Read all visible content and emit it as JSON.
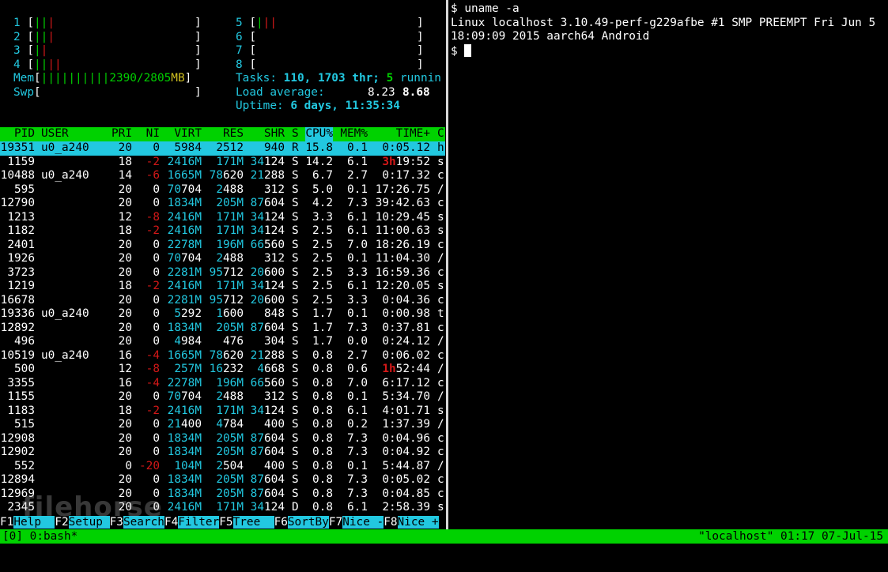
{
  "htop": {
    "cpus": [
      {
        "id": "1",
        "bars": [
          {
            "t": "|",
            "c": "g"
          },
          {
            "t": "|",
            "c": "g"
          },
          {
            "t": "|",
            "c": "r"
          }
        ]
      },
      {
        "id": "2",
        "bars": [
          {
            "t": "|",
            "c": "g"
          },
          {
            "t": "|",
            "c": "g"
          },
          {
            "t": "|",
            "c": "r"
          }
        ]
      },
      {
        "id": "3",
        "bars": [
          {
            "t": "|",
            "c": "g"
          },
          {
            "t": "|",
            "c": "r"
          }
        ]
      },
      {
        "id": "4",
        "bars": [
          {
            "t": "|",
            "c": "g"
          },
          {
            "t": "|",
            "c": "g"
          },
          {
            "t": "|",
            "c": "r"
          },
          {
            "t": "|",
            "c": "r"
          }
        ]
      },
      {
        "id": "5",
        "bars": [
          {
            "t": "|",
            "c": "g"
          },
          {
            "t": "|",
            "c": "r"
          },
          {
            "t": "|",
            "c": "r"
          }
        ]
      },
      {
        "id": "6",
        "bars": []
      },
      {
        "id": "7",
        "bars": []
      },
      {
        "id": "8",
        "bars": []
      }
    ],
    "mem_label": "Mem",
    "mem_bars": "||||||||||",
    "mem_used": "2390",
    "mem_total": "/2805",
    "mem_unit": "MB",
    "swp_label": "Swp",
    "tasks_label": "Tasks: ",
    "tasks_value": "110, 1703 thr; ",
    "running_value": "5",
    "running_label": " runnin",
    "load_label": "Load average: ",
    "load_1": "8.23",
    "load_5": "8.68",
    "uptime_label": "Uptime: ",
    "uptime_value": "6 days, 11:35:34",
    "columns": [
      "PID",
      "USER",
      "PRI",
      "NI",
      "VIRT",
      "RES",
      "SHR",
      "S",
      "CPU%",
      "MEM%",
      "TIME+",
      "C"
    ],
    "processes": [
      {
        "pid": "19351",
        "user": "u0_a240",
        "pri": "20",
        "ni": "0",
        "virt": "5984",
        "res": "2512",
        "shr": "940",
        "s": "R",
        "cpu": "15.8",
        "mem": "0.1",
        "time": "0:05.12",
        "cmd": "h",
        "sel": true
      },
      {
        "pid": "1159",
        "user": "",
        "pri": "18",
        "ni": "-2",
        "virt": "2416M",
        "res": "171M",
        "shr": "34124",
        "s": "S",
        "cpu": "14.2",
        "mem": "6.1",
        "time": "3h19:52",
        "cmd": "s"
      },
      {
        "pid": "10488",
        "user": "u0_a240",
        "pri": "14",
        "ni": "-6",
        "virt": "1665M",
        "res": "78620",
        "shr": "21288",
        "s": "S",
        "cpu": "6.7",
        "mem": "2.7",
        "time": "0:17.32",
        "cmd": "c"
      },
      {
        "pid": "595",
        "user": "",
        "pri": "20",
        "ni": "0",
        "virt": "70704",
        "res": "2488",
        "shr": "312",
        "s": "S",
        "cpu": "5.0",
        "mem": "0.1",
        "time": "17:26.75",
        "cmd": "/"
      },
      {
        "pid": "12790",
        "user": "",
        "pri": "20",
        "ni": "0",
        "virt": "1834M",
        "res": "205M",
        "shr": "87604",
        "s": "S",
        "cpu": "4.2",
        "mem": "7.3",
        "time": "39:42.63",
        "cmd": "c"
      },
      {
        "pid": "1213",
        "user": "",
        "pri": "12",
        "ni": "-8",
        "virt": "2416M",
        "res": "171M",
        "shr": "34124",
        "s": "S",
        "cpu": "3.3",
        "mem": "6.1",
        "time": "10:29.45",
        "cmd": "s"
      },
      {
        "pid": "1182",
        "user": "",
        "pri": "18",
        "ni": "-2",
        "virt": "2416M",
        "res": "171M",
        "shr": "34124",
        "s": "S",
        "cpu": "2.5",
        "mem": "6.1",
        "time": "11:00.63",
        "cmd": "s"
      },
      {
        "pid": "2401",
        "user": "",
        "pri": "20",
        "ni": "0",
        "virt": "2278M",
        "res": "196M",
        "shr": "66560",
        "s": "S",
        "cpu": "2.5",
        "mem": "7.0",
        "time": "18:26.19",
        "cmd": "c"
      },
      {
        "pid": "1926",
        "user": "",
        "pri": "20",
        "ni": "0",
        "virt": "70704",
        "res": "2488",
        "shr": "312",
        "s": "S",
        "cpu": "2.5",
        "mem": "0.1",
        "time": "11:04.30",
        "cmd": "/"
      },
      {
        "pid": "3723",
        "user": "",
        "pri": "20",
        "ni": "0",
        "virt": "2281M",
        "res": "95712",
        "shr": "20600",
        "s": "S",
        "cpu": "2.5",
        "mem": "3.3",
        "time": "16:59.36",
        "cmd": "c"
      },
      {
        "pid": "1219",
        "user": "",
        "pri": "18",
        "ni": "-2",
        "virt": "2416M",
        "res": "171M",
        "shr": "34124",
        "s": "S",
        "cpu": "2.5",
        "mem": "6.1",
        "time": "12:20.05",
        "cmd": "s"
      },
      {
        "pid": "16678",
        "user": "",
        "pri": "20",
        "ni": "0",
        "virt": "2281M",
        "res": "95712",
        "shr": "20600",
        "s": "S",
        "cpu": "2.5",
        "mem": "3.3",
        "time": "0:04.36",
        "cmd": "c"
      },
      {
        "pid": "19336",
        "user": "u0_a240",
        "pri": "20",
        "ni": "0",
        "virt": "5292",
        "res": "1600",
        "shr": "848",
        "s": "S",
        "cpu": "1.7",
        "mem": "0.1",
        "time": "0:00.98",
        "cmd": "t"
      },
      {
        "pid": "12892",
        "user": "",
        "pri": "20",
        "ni": "0",
        "virt": "1834M",
        "res": "205M",
        "shr": "87604",
        "s": "S",
        "cpu": "1.7",
        "mem": "7.3",
        "time": "0:37.81",
        "cmd": "c"
      },
      {
        "pid": "496",
        "user": "",
        "pri": "20",
        "ni": "0",
        "virt": "4984",
        "res": "476",
        "shr": "304",
        "s": "S",
        "cpu": "1.7",
        "mem": "0.0",
        "time": "0:24.12",
        "cmd": "/"
      },
      {
        "pid": "10519",
        "user": "u0_a240",
        "pri": "16",
        "ni": "-4",
        "virt": "1665M",
        "res": "78620",
        "shr": "21288",
        "s": "S",
        "cpu": "0.8",
        "mem": "2.7",
        "time": "0:06.02",
        "cmd": "c"
      },
      {
        "pid": "500",
        "user": "",
        "pri": "12",
        "ni": "-8",
        "virt": "257M",
        "res": "16232",
        "shr": "4668",
        "s": "S",
        "cpu": "0.8",
        "mem": "0.6",
        "time": "1h52:44",
        "cmd": "/"
      },
      {
        "pid": "3355",
        "user": "",
        "pri": "16",
        "ni": "-4",
        "virt": "2278M",
        "res": "196M",
        "shr": "66560",
        "s": "S",
        "cpu": "0.8",
        "mem": "7.0",
        "time": "6:17.12",
        "cmd": "c"
      },
      {
        "pid": "1155",
        "user": "",
        "pri": "20",
        "ni": "0",
        "virt": "70704",
        "res": "2488",
        "shr": "312",
        "s": "S",
        "cpu": "0.8",
        "mem": "0.1",
        "time": "5:34.70",
        "cmd": "/"
      },
      {
        "pid": "1183",
        "user": "",
        "pri": "18",
        "ni": "-2",
        "virt": "2416M",
        "res": "171M",
        "shr": "34124",
        "s": "S",
        "cpu": "0.8",
        "mem": "6.1",
        "time": "4:01.71",
        "cmd": "s"
      },
      {
        "pid": "515",
        "user": "",
        "pri": "20",
        "ni": "0",
        "virt": "21400",
        "res": "4784",
        "shr": "400",
        "s": "S",
        "cpu": "0.8",
        "mem": "0.2",
        "time": "1:37.39",
        "cmd": "/"
      },
      {
        "pid": "12908",
        "user": "",
        "pri": "20",
        "ni": "0",
        "virt": "1834M",
        "res": "205M",
        "shr": "87604",
        "s": "S",
        "cpu": "0.8",
        "mem": "7.3",
        "time": "0:04.96",
        "cmd": "c"
      },
      {
        "pid": "12902",
        "user": "",
        "pri": "20",
        "ni": "0",
        "virt": "1834M",
        "res": "205M",
        "shr": "87604",
        "s": "S",
        "cpu": "0.8",
        "mem": "7.3",
        "time": "0:04.92",
        "cmd": "c"
      },
      {
        "pid": "552",
        "user": "",
        "pri": "0",
        "ni": "-20",
        "virt": "104M",
        "res": "2504",
        "shr": "400",
        "s": "S",
        "cpu": "0.8",
        "mem": "0.1",
        "time": "5:44.87",
        "cmd": "/"
      },
      {
        "pid": "12894",
        "user": "",
        "pri": "20",
        "ni": "0",
        "virt": "1834M",
        "res": "205M",
        "shr": "87604",
        "s": "S",
        "cpu": "0.8",
        "mem": "7.3",
        "time": "0:05.02",
        "cmd": "c"
      },
      {
        "pid": "12969",
        "user": "",
        "pri": "20",
        "ni": "0",
        "virt": "1834M",
        "res": "205M",
        "shr": "87604",
        "s": "S",
        "cpu": "0.8",
        "mem": "7.3",
        "time": "0:04.85",
        "cmd": "c"
      },
      {
        "pid": "2345",
        "user": "",
        "pri": "20",
        "ni": "0",
        "virt": "2416M",
        "res": "171M",
        "shr": "34124",
        "s": "D",
        "cpu": "0.8",
        "mem": "6.1",
        "time": "2:58.39",
        "cmd": "s"
      }
    ],
    "fkeys": [
      {
        "key": "F1",
        "label": "Help  "
      },
      {
        "key": "F2",
        "label": "Setup "
      },
      {
        "key": "F3",
        "label": "Search"
      },
      {
        "key": "F4",
        "label": "Filter"
      },
      {
        "key": "F5",
        "label": "Tree  "
      },
      {
        "key": "F6",
        "label": "SortBy"
      },
      {
        "key": "F7",
        "label": "Nice -"
      },
      {
        "key": "F8",
        "label": "Nice +"
      }
    ]
  },
  "terminal": {
    "lines": [
      "$ uname -a",
      "Linux localhost 3.10.49-perf-g229afbe #1 SMP PREEMPT Fri Jun 5",
      "18:09:09 2015 aarch64 Android"
    ],
    "prompt": "$ "
  },
  "tmux": {
    "left": "[0] 0:bash*",
    "right": "\"localhost\" 01:17 07-Jul-15"
  },
  "watermark": "filehorse"
}
